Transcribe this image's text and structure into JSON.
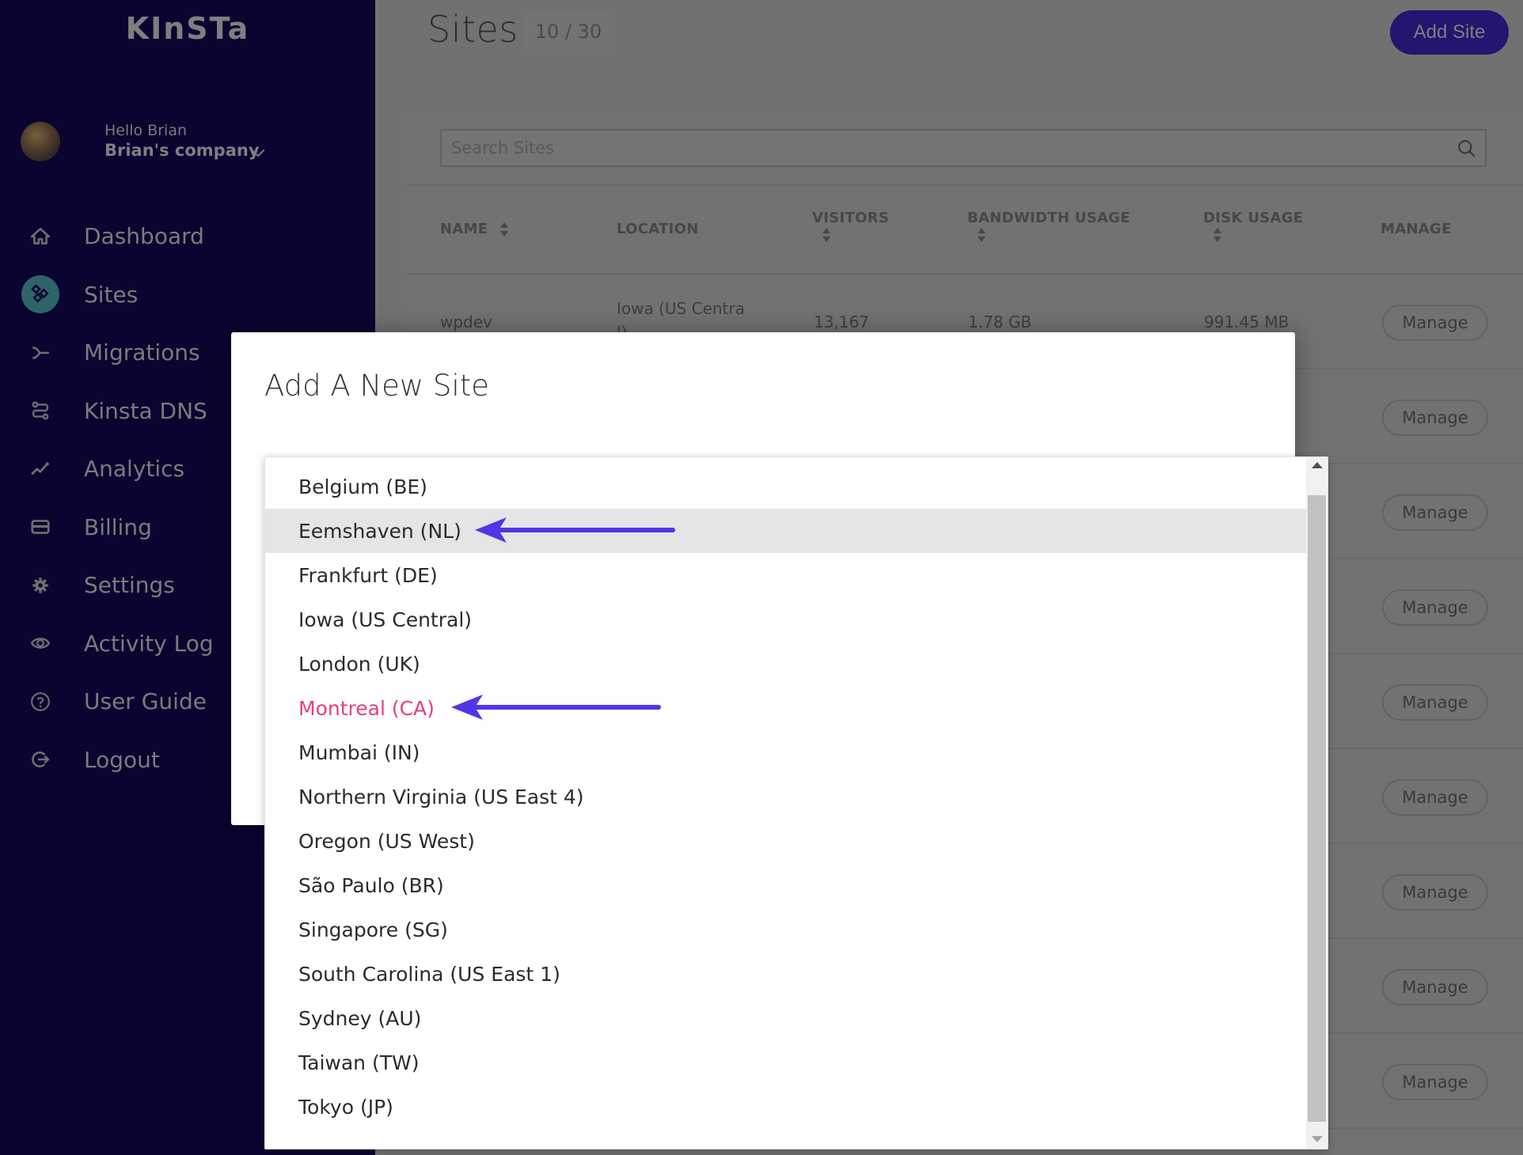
{
  "sidebar": {
    "logo": "KInSTa",
    "user": {
      "greeting": "Hello Brian",
      "company": "Brian's company"
    },
    "nav": [
      {
        "label": "Dashboard",
        "icon": "home-icon"
      },
      {
        "label": "Sites",
        "icon": "sites-icon",
        "active": true
      },
      {
        "label": "Migrations",
        "icon": "migrations-icon"
      },
      {
        "label": "Kinsta DNS",
        "icon": "dns-icon"
      },
      {
        "label": "Analytics",
        "icon": "analytics-icon"
      },
      {
        "label": "Billing",
        "icon": "billing-card-icon"
      },
      {
        "label": "Settings",
        "icon": "gear-icon"
      },
      {
        "label": "Activity Log",
        "icon": "eye-icon"
      },
      {
        "label": "User Guide",
        "icon": "question-circle-icon"
      },
      {
        "label": "Logout",
        "icon": "logout-icon"
      }
    ]
  },
  "header": {
    "title": "Sites",
    "count": "10 / 30",
    "add_site_label": "Add Site"
  },
  "search": {
    "placeholder": "Search Sites",
    "value": ""
  },
  "table": {
    "columns": [
      "NAME",
      "LOCATION",
      "VISITORS",
      "BANDWIDTH USAGE",
      "DISK USAGE",
      "MANAGE"
    ],
    "rows": [
      {
        "name": "wpdev",
        "location": "Iowa (US Centra",
        "location_wrap": "l)",
        "visitors": "13,167",
        "bandwidth": "1.78 GB",
        "disk": "991.45 MB",
        "manage": "Manage"
      },
      {
        "manage": "Manage"
      },
      {
        "manage": "Manage"
      },
      {
        "manage": "Manage"
      },
      {
        "manage": "Manage"
      },
      {
        "manage": "Manage"
      },
      {
        "manage": "Manage"
      },
      {
        "manage": "Manage"
      },
      {
        "manage": "Manage"
      }
    ]
  },
  "modal": {
    "title": "Add A New Site",
    "location_options": [
      "Belgium (BE)",
      "Eemshaven (NL)",
      "Frankfurt (DE)",
      "Iowa (US Central)",
      "London (UK)",
      "Montreal (CA)",
      "Mumbai (IN)",
      "Northern Virginia (US East 4)",
      "Oregon (US West)",
      "São Paulo (BR)",
      "Singapore (SG)",
      "South Carolina (US East 1)",
      "Sydney (AU)",
      "Taiwan (TW)",
      "Tokyo (JP)"
    ],
    "highlighted_option": "Eemshaven (NL)",
    "selected_option": "Montreal (CA)"
  },
  "annotations": {
    "arrow_color": "#4f35e8",
    "arrows_point_to": [
      "Eemshaven (NL)",
      "Montreal (CA)"
    ]
  },
  "colors": {
    "sidebar_bg": "#0b0430",
    "accent": "#231570",
    "selected_text": "#e53e7f",
    "highlight_bg": "#e5e5e5"
  }
}
